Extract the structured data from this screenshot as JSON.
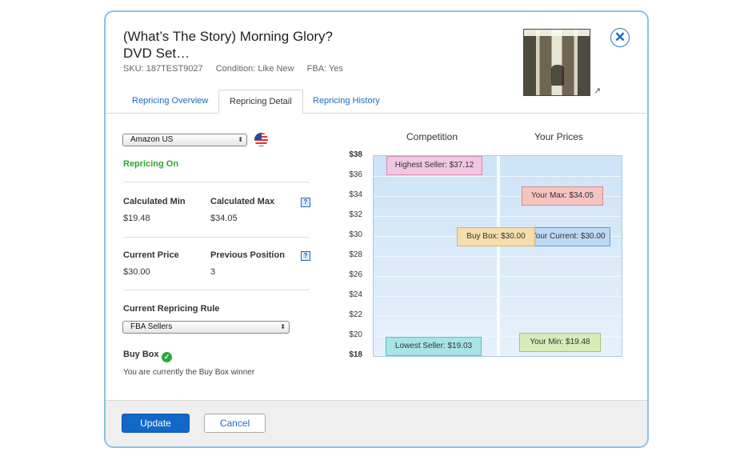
{
  "product": {
    "title_line1": "(What’s The Story) Morning Glory?",
    "title_line2": "DVD Set…",
    "sku": "SKU: 187TEST9027",
    "condition": "Condition: Like New",
    "fba": "FBA: Yes"
  },
  "tabs": [
    {
      "label": "Repricing Overview"
    },
    {
      "label": "Repricing Detail"
    },
    {
      "label": "Repricing History"
    }
  ],
  "detail": {
    "marketplace": "Amazon US",
    "status": "Repricing On",
    "calc_min_label": "Calculated Min",
    "calc_min_value": "$19.48",
    "calc_max_label": "Calculated Max",
    "calc_max_value": "$34.05",
    "current_price_label": "Current Price",
    "current_price_value": "$30.00",
    "prev_position_label": "Previous Position",
    "prev_position_value": "3",
    "rule_label": "Current Repricing Rule",
    "rule_value": "FBA Sellers",
    "buybox_label": "Buy Box",
    "buybox_note": "You are currently the Buy Box winner",
    "help_glyph": "?"
  },
  "chart_data": {
    "type": "range",
    "columns": [
      "Competition",
      "Your Prices"
    ],
    "y_ticks": [
      "$38",
      "$36",
      "$34",
      "$32",
      "$30",
      "$28",
      "$26",
      "$24",
      "$22",
      "$20",
      "$18"
    ],
    "ylim": [
      18,
      38
    ],
    "markers": [
      {
        "column": "Competition",
        "label": "Highest Seller: $37.12",
        "value": 37.12,
        "fill": "#f2c7df",
        "stroke": "#d68ab5"
      },
      {
        "column": "Competition",
        "label": "Buy Box: $30.00",
        "value": 30.0,
        "fill": "#f6deaa",
        "stroke": "#d6b46b"
      },
      {
        "column": "Competition",
        "label": "Lowest Seller: $19.03",
        "value": 19.03,
        "fill": "#a6e4e6",
        "stroke": "#5bbfc3"
      },
      {
        "column": "Your Prices",
        "label": "Your Max: $34.05",
        "value": 34.05,
        "fill": "#f5c4c1",
        "stroke": "#d98c86"
      },
      {
        "column": "Your Prices",
        "label": "Your Current: $30.00",
        "value": 30.0,
        "fill": "#bcd8f5",
        "stroke": "#5e9bd6"
      },
      {
        "column": "Your Prices",
        "label": "Your Min: $19.48",
        "value": 19.48,
        "fill": "#d5ecb8",
        "stroke": "#9fc86b"
      }
    ]
  },
  "footer": {
    "update_label": "Update",
    "cancel_label": "Cancel"
  }
}
